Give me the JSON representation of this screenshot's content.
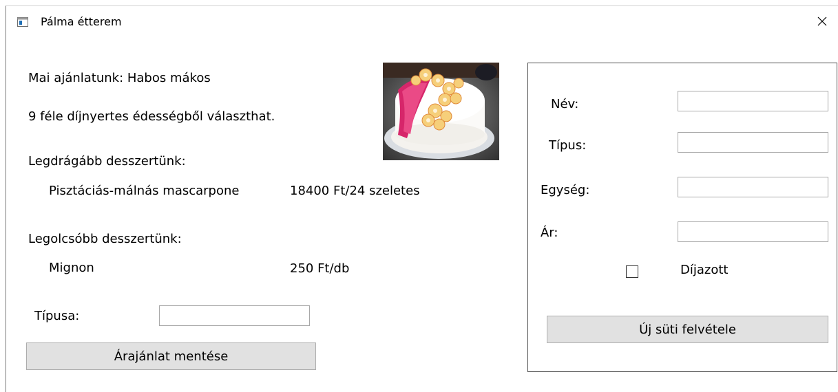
{
  "window": {
    "title": "Pálma étterem",
    "close_symbol": "×"
  },
  "left_panel": {
    "daily_offer": "Mai ajánlatunk: Habos mákos",
    "choice_text": "9 féle díjnyertes édességből választhat.",
    "most_expensive_heading": "Legdrágább desszertünk:",
    "most_expensive_name": "Pisztáciás-málnás mascarpone",
    "most_expensive_price": "18400 Ft/24 szeletes",
    "cheapest_heading": "Legolcsóbb desszertünk:",
    "cheapest_name": "Mignon",
    "cheapest_price": "250 Ft/db",
    "type_label": "Típusa:",
    "type_value": "",
    "save_button": "Árajánlat mentése"
  },
  "right_panel": {
    "name_label": "Név:",
    "name_value": "",
    "type_label": "Típus:",
    "type_value": "",
    "unit_label": "Egység:",
    "unit_value": "",
    "price_label": "Ár:",
    "price_value": "",
    "awarded_label": "Díjazott",
    "awarded_checked": false,
    "add_button": "Új süti felvétele"
  },
  "icons": {
    "app": "window-app-icon",
    "close": "close-icon",
    "image": "cake-photo"
  }
}
